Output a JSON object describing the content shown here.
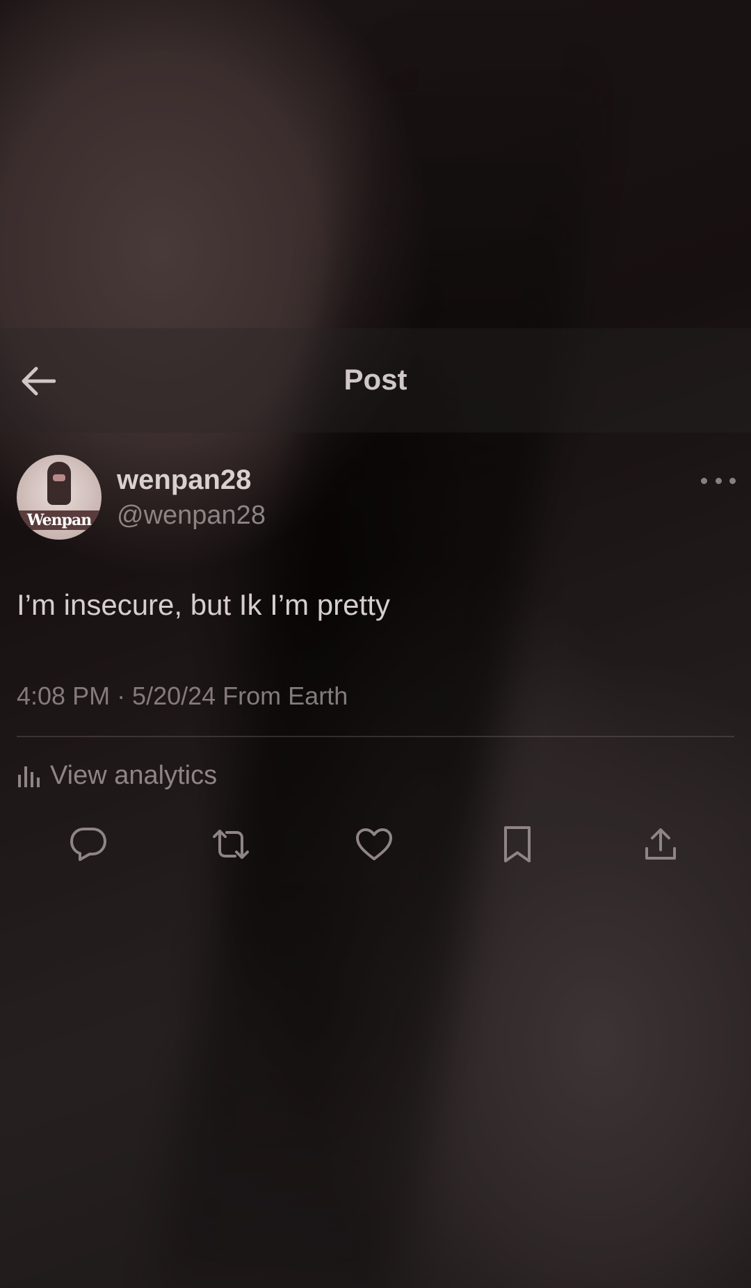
{
  "header": {
    "title": "Post"
  },
  "post": {
    "avatar_text": "Wenpan",
    "display_name": "wenpan28",
    "handle": "@wenpan28",
    "text": "I’m insecure, but Ik I’m pretty",
    "meta": "4:08 PM · 5/20/24 From Earth",
    "analytics_label": "View analytics"
  },
  "actions": [
    "reply-icon",
    "repost-icon",
    "like-icon",
    "bookmark-icon",
    "share-icon"
  ],
  "colors": {
    "text_primary": "#d9d1cf",
    "text_secondary": "#8d8484",
    "icon": "#8f8585"
  }
}
